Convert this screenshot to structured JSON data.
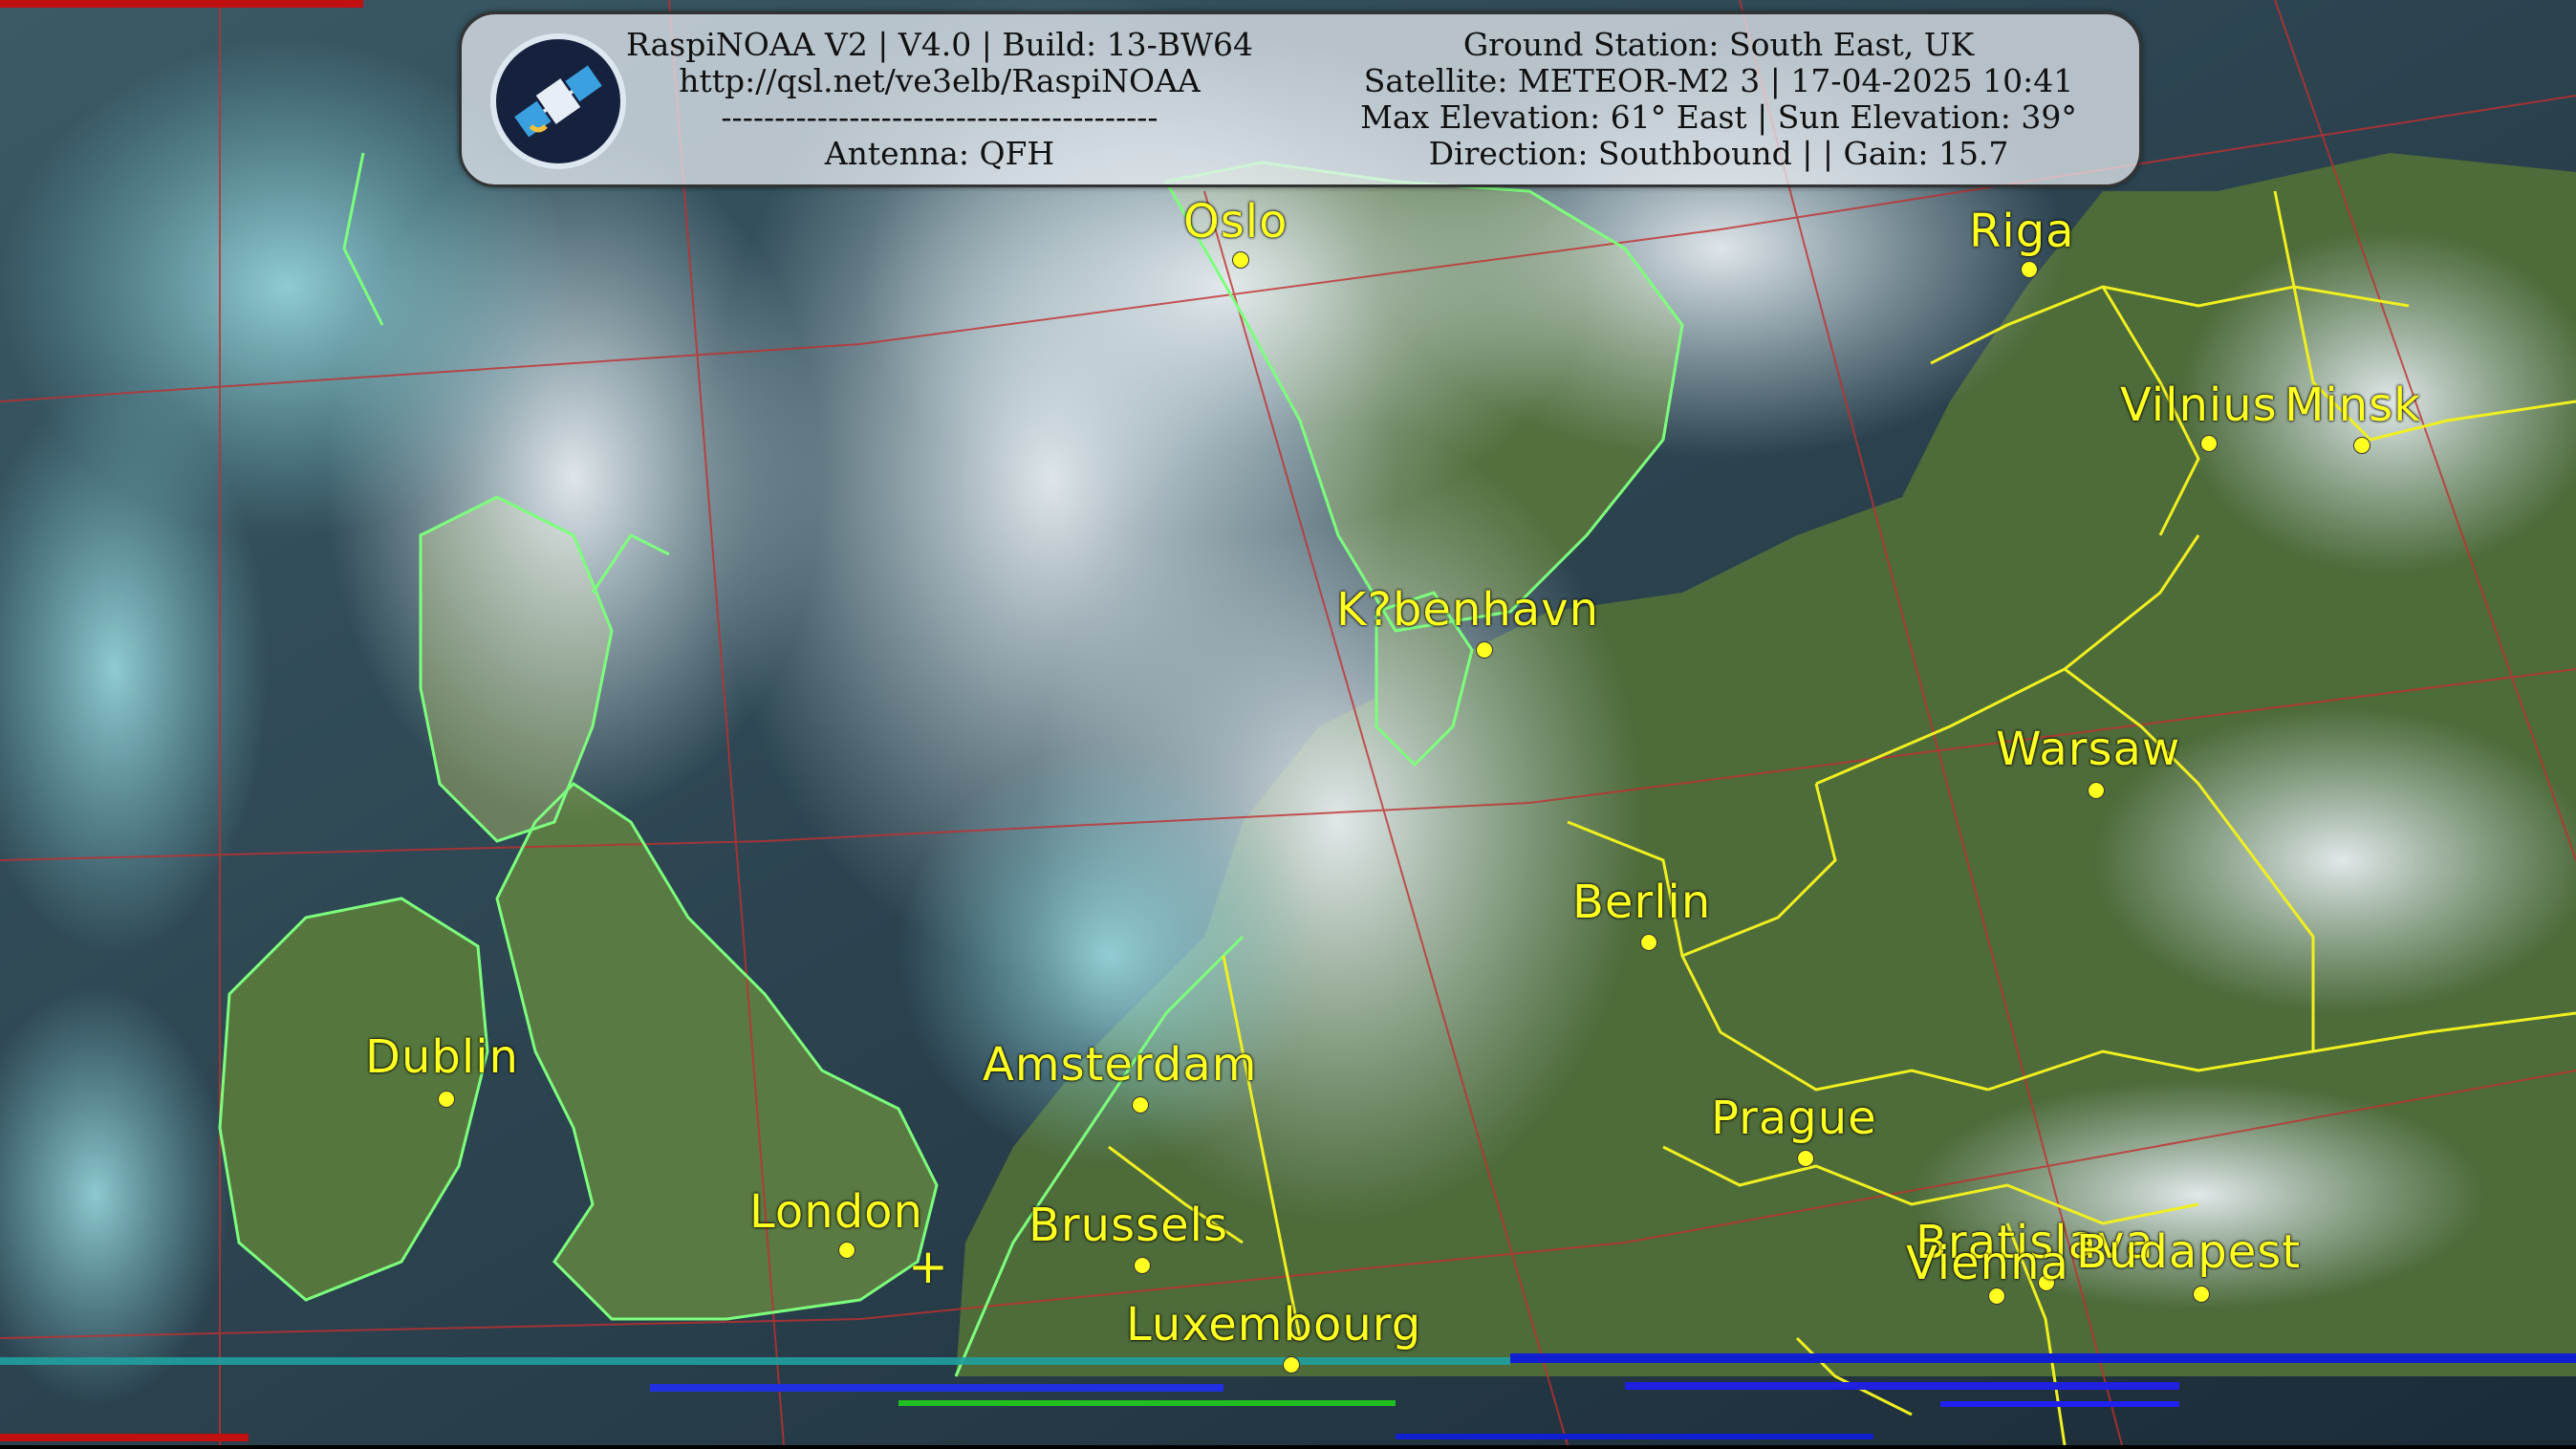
{
  "header": {
    "left_lines": [
      "RaspiNOAA V2 | V4.0 | Build: 13-BW64",
      "http://qsl.net/ve3elb/RaspiNOAA",
      "-----------------------------------------",
      "Antenna: QFH"
    ],
    "right_lines": [
      "Ground Station: South East, UK",
      "Satellite: METEOR-M2 3 | 17-04-2025 10:41",
      "Max Elevation: 61° East | Sun Elevation: 39°",
      "Direction: Southbound | | Gain: 15.7"
    ],
    "logo_icon": "satellite-icon"
  },
  "cities": [
    {
      "name": "Oslo"
    },
    {
      "name": "Riga"
    },
    {
      "name": "Vilnius"
    },
    {
      "name": "Minsk"
    },
    {
      "name": "K?benhavn"
    },
    {
      "name": "Warsaw"
    },
    {
      "name": "Berlin"
    },
    {
      "name": "Dublin"
    },
    {
      "name": "Amsterdam"
    },
    {
      "name": "Prague"
    },
    {
      "name": "London"
    },
    {
      "name": "Brussels"
    },
    {
      "name": "Bratislava"
    },
    {
      "name": "Vienna"
    },
    {
      "name": "Budapest"
    },
    {
      "name": "Luxembourg"
    }
  ],
  "ground_station_marker": "+",
  "colors": {
    "city_labels": "#ffff20",
    "borders": "#f0f020",
    "coastlines": "#7dff7d",
    "grid": "#c03030"
  }
}
